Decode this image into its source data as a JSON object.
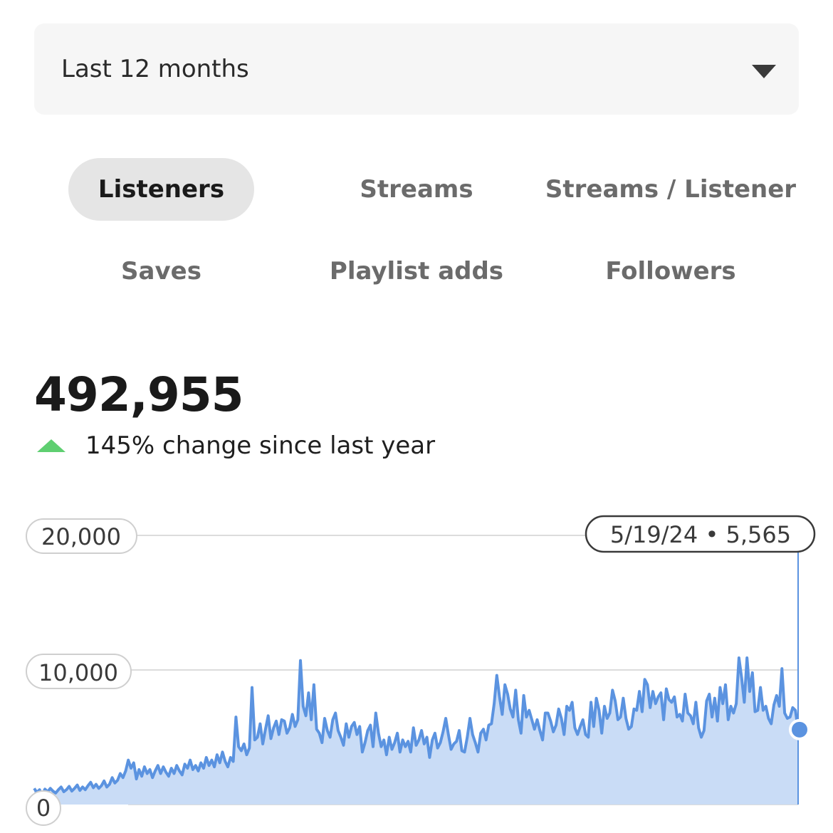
{
  "period_select": {
    "value": "Last 12 months",
    "icon": "caret-down-icon"
  },
  "metric_tabs": [
    {
      "label": "Listeners",
      "active": true
    },
    {
      "label": "Streams",
      "active": false
    },
    {
      "label": "Streams / Listener",
      "active": false
    },
    {
      "label": "Saves",
      "active": false
    },
    {
      "label": "Playlist adds",
      "active": false
    },
    {
      "label": "Followers",
      "active": false
    }
  ],
  "summary": {
    "total": "492,955",
    "change_text": "145% change since last year",
    "trend_icon": "triangle-up-icon",
    "trend_color": "#5fcf71"
  },
  "chart_data": {
    "type": "area",
    "y_tick_labels": [
      "0",
      "10,000",
      "20,000"
    ],
    "ylim": [
      0,
      20000
    ],
    "grid": true,
    "color": "#5b93e0",
    "fill_color": "#c9dcf6",
    "tooltip": {
      "date": "5/19/24",
      "value": "5,565",
      "text": "5/19/24 • 5,565"
    },
    "values": [
      1200,
      900,
      1100,
      700,
      1150,
      950,
      1200,
      1000,
      850,
      1100,
      1300,
      950,
      1100,
      1350,
      1000,
      1200,
      1450,
      1050,
      1300,
      1100,
      1400,
      1650,
      1250,
      1500,
      1200,
      1400,
      1750,
      1300,
      1500,
      2000,
      1600,
      1800,
      2300,
      2000,
      2500,
      3300,
      2700,
      3100,
      1900,
      2600,
      2100,
      2800,
      2300,
      2600,
      2000,
      2500,
      2900,
      2300,
      2800,
      2400,
      2100,
      2700,
      2300,
      2900,
      2500,
      2200,
      3000,
      2700,
      3300,
      2600,
      2900,
      2500,
      3100,
      2700,
      3500,
      2900,
      3300,
      2800,
      3700,
      3100,
      3900,
      3200,
      2800,
      3500,
      3200,
      6500,
      4300,
      4000,
      4500,
      3700,
      4200,
      8700,
      4800,
      5000,
      6000,
      4500,
      5600,
      6600,
      4900,
      5700,
      6200,
      5200,
      6300,
      6200,
      5300,
      5700,
      6700,
      5800,
      6300,
      10700,
      7300,
      6600,
      8300,
      6300,
      8900,
      5600,
      5300,
      4600,
      6400,
      5500,
      5000,
      6300,
      6800,
      5500,
      5000,
      4400,
      6000,
      5000,
      5800,
      6100,
      5200,
      5800,
      3900,
      4600,
      5500,
      5900,
      4300,
      6800,
      5300,
      4300,
      4800,
      3700,
      5000,
      4100,
      4600,
      5300,
      3900,
      4800,
      4300,
      4700,
      3900,
      5700,
      4400,
      4800,
      5500,
      4500,
      5000,
      3500,
      4800,
      5300,
      4200,
      4600,
      5400,
      6400,
      5200,
      4100,
      4500,
      4700,
      5500,
      4000,
      3900,
      5000,
      6400,
      5200,
      4600,
      3900,
      5300,
      5600,
      4800,
      5900,
      6000,
      7500,
      9600,
      8000,
      6700,
      8900,
      8200,
      7100,
      6500,
      8500,
      6300,
      5300,
      8100,
      6500,
      7000,
      6300,
      5600,
      6300,
      5500,
      4800,
      6800,
      6800,
      6200,
      5400,
      5900,
      7100,
      6400,
      5200,
      7300,
      7000,
      7600,
      5700,
      5200,
      5800,
      6300,
      5200,
      5000,
      7600,
      5800,
      7900,
      7000,
      5300,
      7300,
      6400,
      6800,
      8500,
      7700,
      6300,
      6500,
      7900,
      6400,
      5600,
      5800,
      7100,
      7000,
      8400,
      6900,
      9300,
      8900,
      7200,
      8400,
      7500,
      8000,
      8300,
      6300,
      8600,
      7800,
      7600,
      8000,
      6500,
      6700,
      6200,
      8200,
      6800,
      6600,
      6000,
      7600,
      5700,
      5000,
      5500,
      7700,
      8200,
      6500,
      7900,
      6200,
      8700,
      7500,
      8900,
      6300,
      7300,
      6800,
      7500,
      10900,
      9400,
      7600,
      10900,
      8400,
      9800,
      6900,
      7000,
      8700,
      7000,
      7300,
      6400,
      6000,
      7400,
      8100,
      7300,
      10100,
      6800,
      6400,
      6500,
      7200,
      7000,
      5565
    ]
  }
}
